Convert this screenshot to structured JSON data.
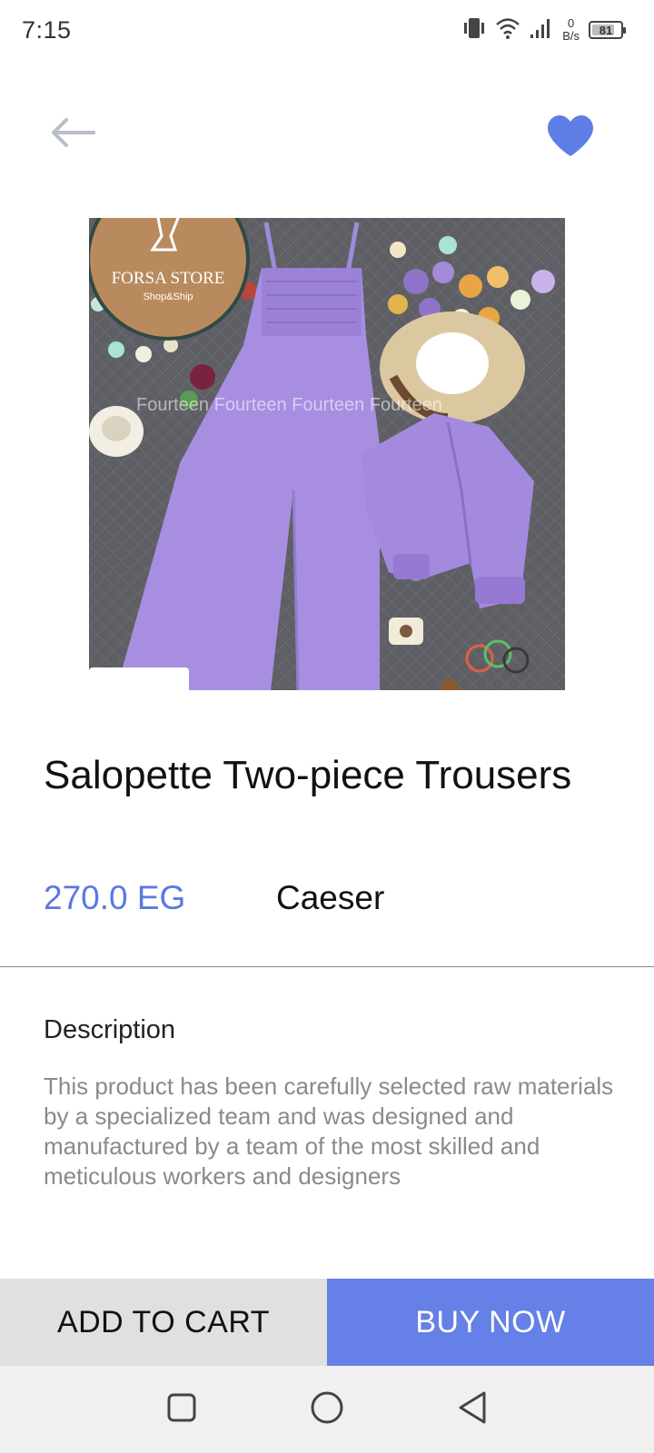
{
  "status_bar": {
    "time": "7:15",
    "net_speed_value": "0",
    "net_speed_unit": "B/s",
    "battery": "81"
  },
  "icons": {
    "back": "arrow-left-icon",
    "favorite": "heart-icon",
    "vibrate": "vibrate-icon",
    "wifi": "wifi-icon",
    "signal": "signal-icon",
    "nav_recents": "square-icon",
    "nav_home": "circle-icon",
    "nav_back": "triangle-back-icon"
  },
  "image": {
    "logo_text": "FORSA STORE",
    "logo_subtext": "Shop&Ship",
    "watermark": "Fourteen Fourteen Fourteen Fourteen"
  },
  "product": {
    "title": "Salopette Two-piece Trousers",
    "price": "270.0 EG",
    "seller": "Caeser"
  },
  "description": {
    "heading": "Description",
    "body": "This product has been carefully selected raw materials by a specialized team and was designed and manufactured by a team of the most skilled and meticulous workers and designers"
  },
  "actions": {
    "add_to_cart": "ADD TO CART",
    "buy_now": "BUY NOW"
  },
  "colors": {
    "accent": "#6580e6",
    "price": "#5b78e3",
    "favorite": "#5f7de6",
    "cart_button_bg": "#e0e0e0",
    "description_text": "#8a8a8a"
  }
}
